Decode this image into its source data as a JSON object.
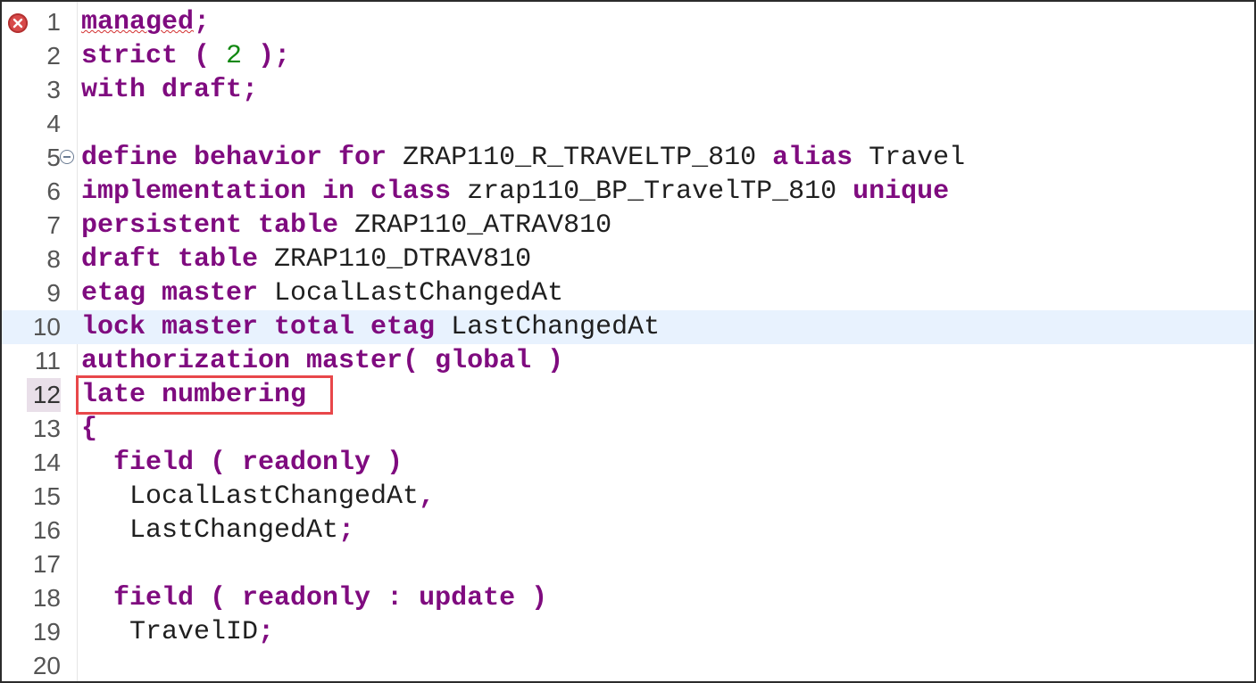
{
  "editor": {
    "highlight_colors": {
      "keyword": "#7f0b7f",
      "number": "#118811",
      "current_line": "#e8f2fe",
      "error": "#d84a4a",
      "highlight_box": "#e8474a"
    },
    "lines": [
      {
        "num": "1",
        "tokens": [
          {
            "t": "managed",
            "k": "kw",
            "err": true
          },
          {
            "t": ";",
            "k": "kw"
          }
        ]
      },
      {
        "num": "2",
        "tokens": [
          {
            "t": "strict",
            "k": "kw"
          },
          {
            "t": " ( ",
            "k": "kw"
          },
          {
            "t": "2",
            "k": "num"
          },
          {
            "t": " );",
            "k": "kw"
          }
        ]
      },
      {
        "num": "3",
        "tokens": [
          {
            "t": "with draft;",
            "k": "kw"
          }
        ]
      },
      {
        "num": "4",
        "tokens": []
      },
      {
        "num": "5",
        "tokens": [
          {
            "t": "define behavior for ",
            "k": "kw"
          },
          {
            "t": "ZRAP110_R_TRAVELTP_810 "
          },
          {
            "t": "alias ",
            "k": "kw"
          },
          {
            "t": "Travel"
          }
        ]
      },
      {
        "num": "6",
        "tokens": [
          {
            "t": "implementation in class ",
            "k": "kw"
          },
          {
            "t": "zrap110_BP_TravelTP_810 "
          },
          {
            "t": "unique",
            "k": "kw"
          }
        ]
      },
      {
        "num": "7",
        "tokens": [
          {
            "t": "persistent table ",
            "k": "kw"
          },
          {
            "t": "ZRAP110_ATRAV810"
          }
        ]
      },
      {
        "num": "8",
        "tokens": [
          {
            "t": "draft table ",
            "k": "kw"
          },
          {
            "t": "ZRAP110_DTRAV810"
          }
        ]
      },
      {
        "num": "9",
        "tokens": [
          {
            "t": "etag master ",
            "k": "kw"
          },
          {
            "t": "LocalLastChangedAt"
          }
        ]
      },
      {
        "num": "10",
        "tokens": [
          {
            "t": "lock master total etag ",
            "k": "kw"
          },
          {
            "t": "LastChangedAt"
          }
        ]
      },
      {
        "num": "11",
        "tokens": [
          {
            "t": "authorization master( global )",
            "k": "kw"
          }
        ]
      },
      {
        "num": "12",
        "tokens": [
          {
            "t": "late numbering",
            "k": "kw"
          }
        ]
      },
      {
        "num": "13",
        "tokens": [
          {
            "t": "{",
            "k": "kw"
          }
        ]
      },
      {
        "num": "14",
        "tokens": [
          {
            "t": "  "
          },
          {
            "t": "field ( readonly )",
            "k": "kw"
          }
        ]
      },
      {
        "num": "15",
        "tokens": [
          {
            "t": "   LocalLastChangedAt"
          },
          {
            "t": ",",
            "k": "kw"
          }
        ]
      },
      {
        "num": "16",
        "tokens": [
          {
            "t": "   LastChangedAt"
          },
          {
            "t": ";",
            "k": "kw"
          }
        ]
      },
      {
        "num": "17",
        "tokens": []
      },
      {
        "num": "18",
        "tokens": [
          {
            "t": "  "
          },
          {
            "t": "field ( readonly : update )",
            "k": "kw"
          }
        ]
      },
      {
        "num": "19",
        "tokens": [
          {
            "t": "   TravelID"
          },
          {
            "t": ";",
            "k": "kw"
          }
        ]
      },
      {
        "num": "20",
        "tokens": []
      }
    ],
    "current_line": "10",
    "active_line_number": "12",
    "error_line": "1",
    "fold_line": "5",
    "icons": {
      "error": "error-icon",
      "fold": "fold-collapse-icon"
    }
  }
}
